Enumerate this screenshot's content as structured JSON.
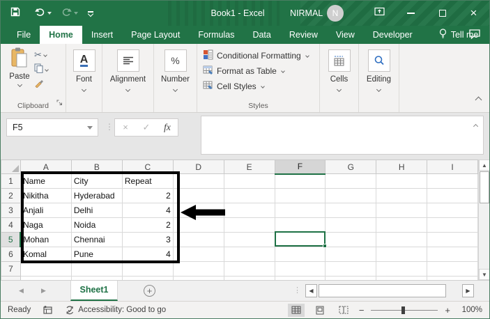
{
  "titlebar": {
    "title": "Book1  -  Excel",
    "user": "NIRMAL",
    "avatar_initial": "N"
  },
  "tabs": {
    "items": [
      {
        "label": "File"
      },
      {
        "label": "Home"
      },
      {
        "label": "Insert"
      },
      {
        "label": "Page Layout"
      },
      {
        "label": "Formulas"
      },
      {
        "label": "Data"
      },
      {
        "label": "Review"
      },
      {
        "label": "View"
      },
      {
        "label": "Developer"
      }
    ],
    "tell_me": "Tell me"
  },
  "ribbon": {
    "clipboard": {
      "paste": "Paste",
      "label": "Clipboard"
    },
    "font": {
      "label": "Font"
    },
    "alignment": {
      "label": "Alignment"
    },
    "number": {
      "label": "Number"
    },
    "styles": {
      "items": [
        "Conditional Formatting",
        "Format as Table",
        "Cell Styles"
      ],
      "label": "Styles"
    },
    "cells": {
      "label": "Cells"
    },
    "editing": {
      "label": "Editing"
    }
  },
  "formula_bar": {
    "name_box": "F5",
    "fx_label": "fx",
    "formula_value": ""
  },
  "grid": {
    "columns": [
      "A",
      "B",
      "C",
      "D",
      "E",
      "F",
      "G",
      "H",
      "I"
    ],
    "row_count": 8,
    "selected": {
      "cell": "F5",
      "column": "F",
      "row": 5
    },
    "table": {
      "headers": [
        "Name",
        "City",
        "Repeat"
      ],
      "rows": [
        [
          "Nikitha",
          "Hyderabad",
          "2"
        ],
        [
          "Anjali",
          "Delhi",
          "4"
        ],
        [
          "Naga",
          "Noida",
          "2"
        ],
        [
          "Mohan",
          "Chennai",
          "3"
        ],
        [
          "Komal",
          "Pune",
          "4"
        ]
      ]
    }
  },
  "sheet_bar": {
    "tab": "Sheet1"
  },
  "status_bar": {
    "mode": "Ready",
    "accessibility": "Accessibility: Good to go",
    "zoom_level": "100%"
  },
  "colors": {
    "brand_green": "#217346",
    "selection_green": "#1e7145",
    "annotation_black": "#000000"
  },
  "icons": {
    "up_triangle": "▲",
    "down_triangle": "▼",
    "left_triangle": "◀",
    "right_triangle": "▶",
    "dots": "⋮",
    "close": "×",
    "cancel": "×",
    "check": "✓",
    "scissors": "✂",
    "percent": "%",
    "letter_a": "A",
    "plus": "+",
    "minus": "−"
  }
}
